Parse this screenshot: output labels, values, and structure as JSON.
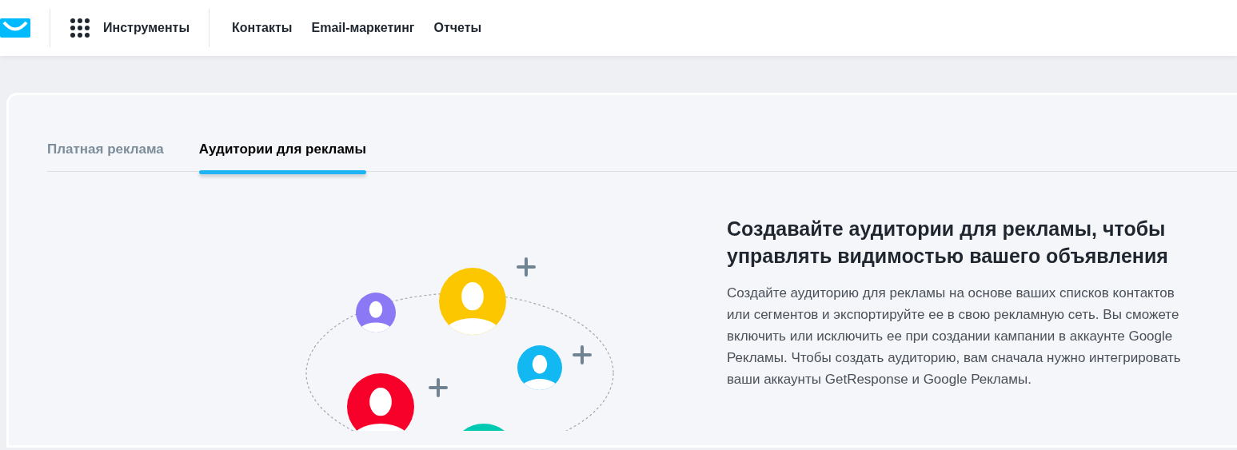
{
  "header": {
    "tools_label": "Инструменты",
    "nav_links": [
      {
        "label": "Контакты"
      },
      {
        "label": "Email-маркетинг"
      },
      {
        "label": "Отчеты"
      }
    ]
  },
  "tabs": [
    {
      "label": "Платная реклама",
      "selected": false
    },
    {
      "label": "Аудитории для рекламы",
      "selected": true
    }
  ],
  "intro": {
    "heading": "Создавайте аудитории для рекламы, чтобы управлять видимостью вашего объявления",
    "text": "Создайте аудиторию для рекламы на основе ваших списков контактов или сегментов и экспортируйте ее в свою рекламную сеть. Вы сможете включить или исключить ее при создании кампании в аккаунте Google Рекламы. Чтобы создать аудиторию, вам сначала нужно интегрировать ваши аккаунты GetResponse и Google Рекламы."
  }
}
